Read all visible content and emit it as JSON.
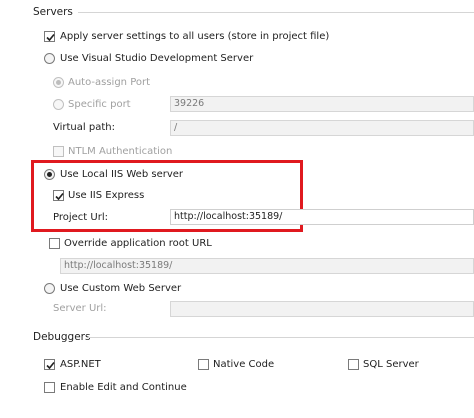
{
  "servers": {
    "title": "Servers",
    "apply_settings_label": "Apply server settings to all users (store in project file)",
    "use_vs_dev_server_label": "Use Visual Studio Development Server",
    "auto_assign_port_label": "Auto-assign Port",
    "specific_port_label": "Specific port",
    "specific_port_value": "39226",
    "virtual_path_label": "Virtual path:",
    "virtual_path_value": "/",
    "ntlm_auth_label": "NTLM Authentication",
    "use_local_iis_label": "Use Local IIS Web server",
    "use_iis_express_label": "Use IIS Express",
    "project_url_label": "Project Url:",
    "project_url_value": "http://localhost:35189/",
    "override_root_label": "Override application root URL",
    "override_root_value": "http://localhost:35189/",
    "use_custom_server_label": "Use Custom Web Server",
    "server_url_label": "Server Url:",
    "server_url_value": ""
  },
  "debuggers": {
    "title": "Debuggers",
    "aspnet_label": "ASP.NET",
    "native_code_label": "Native Code",
    "sql_server_label": "SQL Server",
    "edit_continue_label": "Enable Edit and Continue"
  }
}
